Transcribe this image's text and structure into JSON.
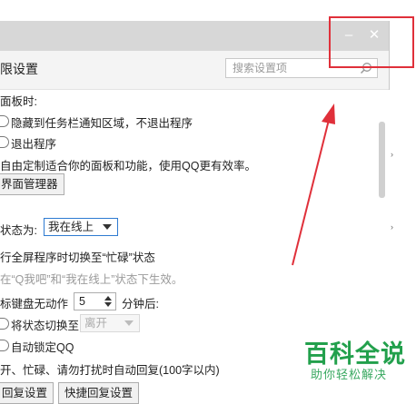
{
  "window": {
    "minimize_icon": "minimize-icon",
    "close_icon": "close-icon",
    "minimize_glyph": "–",
    "close_glyph": "✕"
  },
  "header": {
    "title": "限设置",
    "search_placeholder": "搜索设置项",
    "search_icon": "search-icon"
  },
  "panel_section": {
    "heading": "面板时:",
    "option_hide": "隐藏到任务栏通知区域，不退出程序",
    "option_exit": "退出程序",
    "custom_text": "自由定制适合你的面板和功能，使用QQ更有效率。",
    "manager_button": "界面管理器"
  },
  "status_section": {
    "label": "状态为:",
    "selected": "我在线上",
    "fullscreen_text": "行全屏程序时切换至“忙碌”状态",
    "note": "在“Q我吧”和“我在线上”状态下生效。",
    "idle_label": "标键盘无动作",
    "idle_minutes": "5",
    "idle_suffix": "分钟后:",
    "switch_to_label": "将状态切换至",
    "switch_to_value": "离开",
    "auto_lock": "自动锁定QQ",
    "auto_reply_text": "开、忙碌、请勿打扰时自动回复(100字以内)",
    "reply_settings_button": "回复设置",
    "quick_reply_button": "快捷回复设置"
  },
  "watermark": {
    "brand": "百科全说",
    "tagline": "助你轻松解决"
  },
  "colors": {
    "titlebar": "#d7d7d7",
    "annotation_red": "#e0303a",
    "select_border": "#2e7bd1",
    "watermark_green": "#22a04c"
  }
}
